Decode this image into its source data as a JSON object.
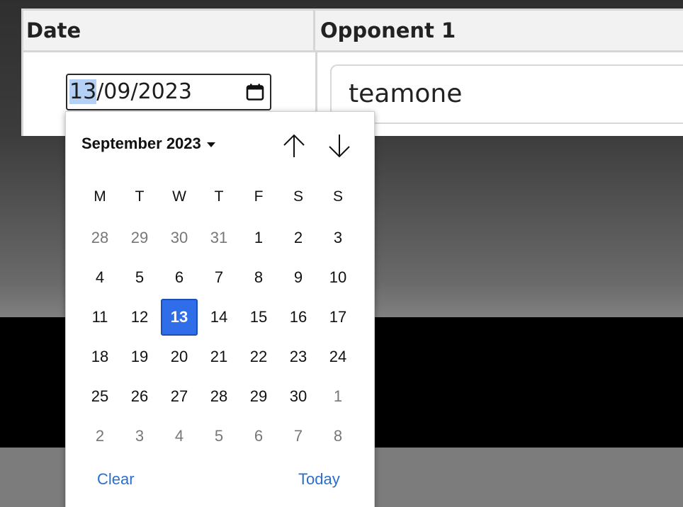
{
  "table": {
    "headers": [
      "Date",
      "Opponent 1"
    ],
    "date_value": {
      "day": "13",
      "rest": "/09/2023"
    },
    "opponent_value": "teamone"
  },
  "calendar": {
    "month_label": "September 2023",
    "weekdays": [
      "M",
      "T",
      "W",
      "T",
      "F",
      "S",
      "S"
    ],
    "weeks": [
      [
        {
          "d": "28",
          "o": true
        },
        {
          "d": "29",
          "o": true
        },
        {
          "d": "30",
          "o": true
        },
        {
          "d": "31",
          "o": true
        },
        {
          "d": "1"
        },
        {
          "d": "2"
        },
        {
          "d": "3"
        }
      ],
      [
        {
          "d": "4"
        },
        {
          "d": "5"
        },
        {
          "d": "6"
        },
        {
          "d": "7"
        },
        {
          "d": "8"
        },
        {
          "d": "9"
        },
        {
          "d": "10"
        }
      ],
      [
        {
          "d": "11"
        },
        {
          "d": "12"
        },
        {
          "d": "13",
          "s": true
        },
        {
          "d": "14"
        },
        {
          "d": "15"
        },
        {
          "d": "16"
        },
        {
          "d": "17"
        }
      ],
      [
        {
          "d": "18"
        },
        {
          "d": "19"
        },
        {
          "d": "20"
        },
        {
          "d": "21"
        },
        {
          "d": "22"
        },
        {
          "d": "23"
        },
        {
          "d": "24"
        }
      ],
      [
        {
          "d": "25"
        },
        {
          "d": "26"
        },
        {
          "d": "27"
        },
        {
          "d": "28"
        },
        {
          "d": "29"
        },
        {
          "d": "30"
        },
        {
          "d": "1",
          "o": true
        }
      ],
      [
        {
          "d": "2",
          "o": true
        },
        {
          "d": "3",
          "o": true
        },
        {
          "d": "4",
          "o": true
        },
        {
          "d": "5",
          "o": true
        },
        {
          "d": "6",
          "o": true
        },
        {
          "d": "7",
          "o": true
        },
        {
          "d": "8",
          "o": true
        }
      ]
    ],
    "clear_label": "Clear",
    "today_label": "Today",
    "selected_color": "#2f6ee8",
    "link_color": "#2a6fce",
    "icons": {
      "calendar": "calendar-icon",
      "prev": "arrow-up-icon",
      "next": "arrow-down-icon",
      "month_menu": "caret-down-icon"
    }
  }
}
